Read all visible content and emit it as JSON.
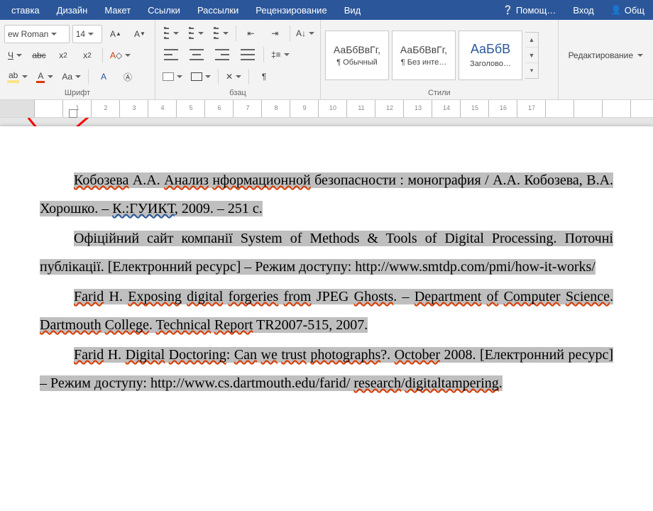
{
  "tabs": {
    "insert": "ставка",
    "design": "Дизайн",
    "layout": "Макет",
    "references": "Ссылки",
    "mailings": "Рассылки",
    "review": "Рецензирование",
    "view": "Вид",
    "help": "Помощ…",
    "signin": "Вход",
    "share": "Общ"
  },
  "font": {
    "name": "ew Roman",
    "size": "14",
    "group_label": "Шрифт"
  },
  "paragraph": {
    "group_label": "бзац"
  },
  "styles": {
    "group_label": "Стили",
    "items": [
      {
        "preview": "АаБбВвГг,",
        "label": "¶ Обычный"
      },
      {
        "preview": "АаБбВвГг,",
        "label": "¶ Без инте…"
      },
      {
        "preview": "АаБбВ",
        "label": "Заголово…"
      }
    ]
  },
  "editing": {
    "label": "Редактирование"
  },
  "ruler": {
    "numbers": [
      "",
      "1",
      "2",
      "3",
      "4",
      "5",
      "6",
      "7",
      "8",
      "9",
      "10",
      "11",
      "12",
      "13",
      "14",
      "15",
      "16",
      "17"
    ]
  },
  "doc": {
    "p1": {
      "s1": "Кобозева",
      "t1": " А.А. ",
      "s2": "Анализ",
      "t2": " ",
      "s3": "нформационной",
      "t3": " безопасности : монография / А.А. Кобозева, В.А. Хорошко. – ",
      "s4": "К.:ГУИКТ",
      "t4": ", 2009. – 251 с."
    },
    "p2": {
      "t1": "Офіційний сайт компанії System of Methods & Tools of Digital Processing. Поточні публікації. [Електронний ресурс] – Режим доступу: http://www.smtdp.com/pmi/how-it-works/"
    },
    "p3": {
      "s1": "Farid",
      "t1": " H. ",
      "s2": "Exposing",
      "t2": " ",
      "s3": "digital",
      "t3": " ",
      "s4": "forgeries",
      "t4": " ",
      "s5": "from",
      "t5": " JPEG ",
      "s6": "Ghosts",
      "t6": ". – ",
      "s7": "Department",
      "t7": " ",
      "s8": "of",
      "t8": " ",
      "s9": "Computer",
      "t9": " ",
      "s10": "Science",
      "t10": ". ",
      "s11": "Dartmouth",
      "t11": " ",
      "s12": "College",
      "t12": ". ",
      "s13": "Technical",
      "t13": " ",
      "s14": "Report",
      "t14": " TR2007-515, 2007."
    },
    "p4": {
      "s1": "Farid",
      "t1": " H. ",
      "s2": "Digital",
      "t2": " ",
      "s3": "Doctoring",
      "t3": ": ",
      "s4": "Can",
      "t4": " ",
      "s5": "we",
      "t5": " ",
      "s6": "trust",
      "t6": " ",
      "s7": "photographs",
      "t7": "?. ",
      "s8": "October",
      "t8": " 2008. [Електронний ресурс] – Режим доступу: http://www.cs.dartmouth.edu/farid/ ",
      "s9": "research",
      "t9": "/",
      "s10": "digitaltampering",
      "t10": "."
    }
  }
}
